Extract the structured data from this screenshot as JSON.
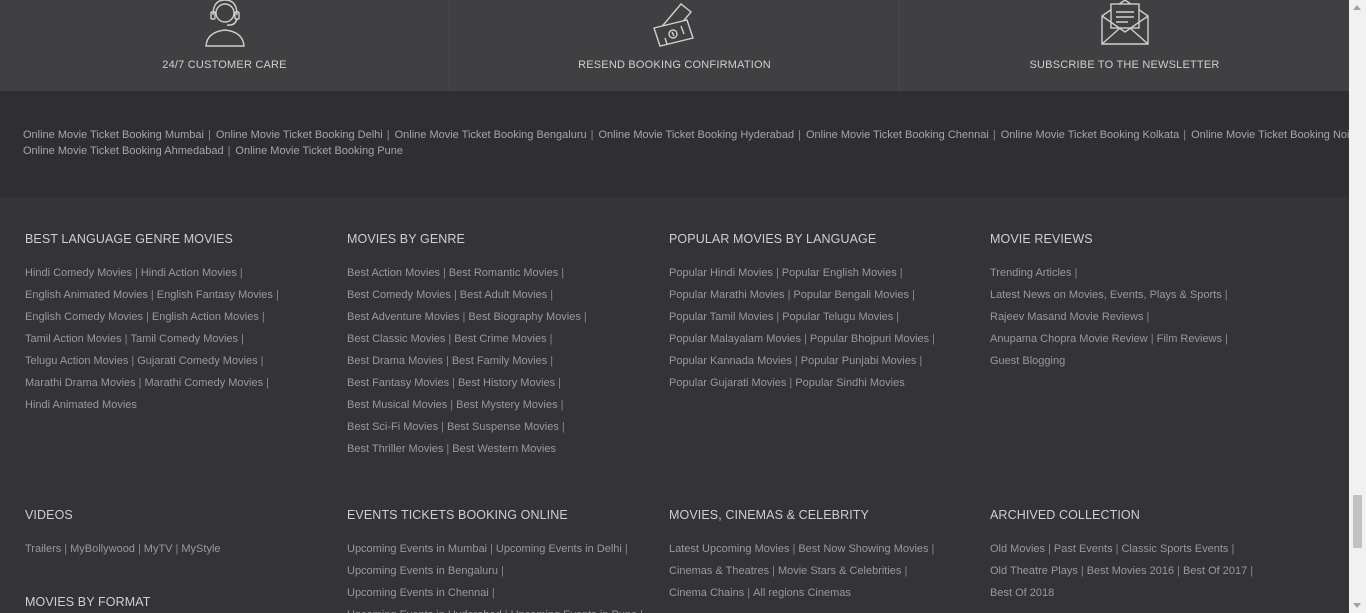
{
  "services": [
    {
      "label": "24/7 CUSTOMER CARE",
      "icon": "customer-care-icon"
    },
    {
      "label": "RESEND BOOKING CONFIRMATION",
      "icon": "ticket-icon"
    },
    {
      "label": "SUBSCRIBE TO THE NEWSLETTER",
      "icon": "envelope-icon"
    }
  ],
  "cities_row1": [
    "Online Movie Ticket Booking Mumbai",
    "Online Movie Ticket Booking Delhi",
    "Online Movie Ticket Booking Bengaluru",
    "Online Movie Ticket Booking Hyderabad",
    "Online Movie Ticket Booking Chennai",
    "Online Movie Ticket Booking Kolkata",
    "Online Movie Ticket Booking Noida"
  ],
  "cities_row2": [
    "Online Movie Ticket Booking Ahmedabad",
    "Online Movie Ticket Booking Pune"
  ],
  "sections": [
    {
      "title": "BEST LANGUAGE GENRE MOVIES",
      "lines": [
        [
          "Hindi Comedy Movies",
          "Hindi Action Movies",
          ""
        ],
        [
          "English Animated Movies",
          "English Fantasy Movies",
          ""
        ],
        [
          "English Comedy Movies",
          "English Action Movies",
          ""
        ],
        [
          "Tamil Action Movies",
          "Tamil Comedy Movies",
          ""
        ],
        [
          "Telugu Action Movies",
          "Gujarati Comedy Movies",
          ""
        ],
        [
          "Marathi Drama Movies",
          "Marathi Comedy Movies",
          ""
        ],
        [
          "Hindi Animated Movies"
        ]
      ]
    },
    {
      "title": "MOVIES BY GENRE",
      "lines": [
        [
          "Best Action Movies",
          "Best Romantic Movies",
          ""
        ],
        [
          "Best Comedy Movies",
          "Best Adult Movies",
          ""
        ],
        [
          "Best Adventure Movies",
          "Best Biography Movies",
          ""
        ],
        [
          "Best Classic Movies",
          "Best Crime Movies",
          ""
        ],
        [
          "Best Drama Movies",
          "Best Family Movies",
          ""
        ],
        [
          "Best Fantasy Movies",
          "Best History Movies",
          ""
        ],
        [
          "Best Musical Movies",
          "Best Mystery Movies",
          ""
        ],
        [
          "Best Sci-Fi Movies",
          "Best Suspense Movies",
          ""
        ],
        [
          "Best Thriller Movies",
          "Best Western Movies"
        ]
      ]
    },
    {
      "title": "POPULAR MOVIES BY LANGUAGE",
      "lines": [
        [
          "Popular Hindi Movies",
          "Popular English Movies",
          ""
        ],
        [
          "Popular Marathi Movies",
          "Popular Bengali Movies",
          ""
        ],
        [
          "Popular Tamil Movies",
          "Popular Telugu Movies",
          ""
        ],
        [
          "Popular Malayalam Movies",
          "Popular Bhojpuri Movies",
          ""
        ],
        [
          "Popular Kannada Movies",
          "Popular Punjabi Movies",
          ""
        ],
        [
          "Popular Gujarati Movies",
          "Popular Sindhi Movies"
        ]
      ]
    },
    {
      "title": "MOVIE REVIEWS",
      "lines": [
        [
          "Trending Articles",
          ""
        ],
        [
          "Latest News on Movies, Events, Plays & Sports",
          ""
        ],
        [
          "Rajeev Masand Movie Reviews",
          ""
        ],
        [
          "Anupama Chopra Movie Review",
          "Film Reviews",
          ""
        ],
        [
          "Guest Blogging"
        ]
      ]
    },
    {
      "title": "VIDEOS",
      "lines": [
        [
          "Trailers",
          "MyBollywood",
          "MyTV",
          "MyStyle"
        ]
      ]
    },
    {
      "title": "EVENTS TICKETS BOOKING ONLINE",
      "lines": [
        [
          "Upcoming Events in Mumbai",
          "Upcoming Events in Delhi",
          ""
        ],
        [
          "Upcoming Events in Bengaluru",
          ""
        ],
        [
          "Upcoming Events in Chennai",
          ""
        ],
        [
          "Upcoming Events in Hyderabad",
          "Upcoming Events in Pune",
          ""
        ]
      ]
    },
    {
      "title": "MOVIES, CINEMAS & CELEBRITY",
      "lines": [
        [
          "Latest Upcoming Movies",
          "Best Now Showing Movies",
          ""
        ],
        [
          "Cinemas & Theatres",
          "Movie Stars & Celebrities",
          ""
        ],
        [
          "Cinema Chains",
          "All regions Cinemas"
        ]
      ]
    },
    {
      "title": "ARCHIVED COLLECTION",
      "lines": [
        [
          "Old Movies",
          "Past Events",
          "Classic Sports Events",
          ""
        ],
        [
          "Old Theatre Plays",
          "Best Movies 2016",
          "Best Of 2017",
          ""
        ],
        [
          "Best Of 2018"
        ]
      ]
    },
    {
      "title": "MOVIES BY FORMAT",
      "lines": []
    }
  ]
}
